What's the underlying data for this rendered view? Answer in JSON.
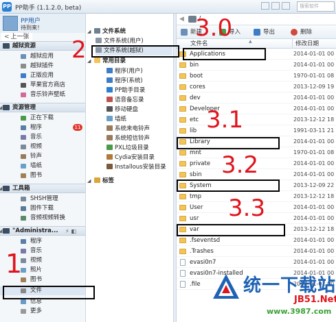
{
  "window": {
    "title": "PP助手 (1.1.2.0, beta)",
    "logo": "PP",
    "search_placeholder": "搜索软件"
  },
  "user": {
    "name": "PP用户",
    "login": "待到来！"
  },
  "back_label": "上一张",
  "sidebar": {
    "sections": [
      {
        "title": "越狱资源",
        "items": [
          {
            "label": "越狱应用"
          },
          {
            "label": "越狱插件"
          },
          {
            "label": "正版应用"
          },
          {
            "label": "苹果官方商店"
          },
          {
            "label": "音乐铃声壁纸"
          }
        ]
      },
      {
        "title": "资源管理",
        "items": [
          {
            "label": "正在下载"
          },
          {
            "label": "程序",
            "badge": "11"
          },
          {
            "label": "音乐"
          },
          {
            "label": "视频"
          },
          {
            "label": "铃声"
          },
          {
            "label": "墙纸"
          },
          {
            "label": "图书"
          }
        ]
      },
      {
        "title": "工具箱",
        "items": [
          {
            "label": "SHSH管理"
          },
          {
            "label": "固件下载"
          },
          {
            "label": "音频视频转换"
          }
        ]
      },
      {
        "title": "\"Administra...",
        "items": [
          {
            "label": "程序"
          },
          {
            "label": "音乐"
          },
          {
            "label": "视频"
          },
          {
            "label": "照片"
          },
          {
            "label": "图书"
          },
          {
            "label": "文件"
          },
          {
            "label": "信息"
          },
          {
            "label": "更多"
          }
        ]
      }
    ]
  },
  "tree": {
    "root1": "文件系统",
    "fs_user": "文件系统(用户)",
    "fs_jb": "文件系统(越狱)",
    "root2": "常用目录",
    "common": [
      "程序(用户)",
      "程序(系统)",
      "PP助手目录",
      "语音备忘录",
      "移动硬盘",
      "墙纸",
      "系统来电铃声",
      "系统短信铃声",
      "PXL垃圾目录",
      "Cydia安装目录",
      "Installous安装目录"
    ],
    "root3": "标签"
  },
  "path": "/",
  "toolbar": {
    "new": "新建",
    "import": "导入",
    "export": "导出",
    "delete": "删除"
  },
  "columns": {
    "name": "文件名",
    "date": "修改日期"
  },
  "files": [
    {
      "name": "Applications",
      "date": "2014-01-01 00",
      "type": "folder"
    },
    {
      "name": "bin",
      "date": "2014-01-01 00",
      "type": "folder"
    },
    {
      "name": "boot",
      "date": "1970-01-01 08",
      "type": "folder"
    },
    {
      "name": "cores",
      "date": "2013-12-09 19",
      "type": "folder"
    },
    {
      "name": "dev",
      "date": "2014-01-01 00",
      "type": "folder"
    },
    {
      "name": "Developer",
      "date": "2014-01-01 00",
      "type": "folder"
    },
    {
      "name": "etc",
      "date": "2013-12-12 18",
      "type": "folder"
    },
    {
      "name": "lib",
      "date": "1991-03-11 21",
      "type": "folder"
    },
    {
      "name": "Library",
      "date": "2014-01-01 00",
      "type": "folder"
    },
    {
      "name": "mnt",
      "date": "1970-01-01 08",
      "type": "folder"
    },
    {
      "name": "private",
      "date": "2014-01-01 00",
      "type": "folder"
    },
    {
      "name": "sbin",
      "date": "2014-01-01 00",
      "type": "folder"
    },
    {
      "name": "System",
      "date": "2013-12-09 22",
      "type": "folder"
    },
    {
      "name": "tmp",
      "date": "2013-12-12 18",
      "type": "folder"
    },
    {
      "name": "User",
      "date": "2014-01-01 00",
      "type": "folder"
    },
    {
      "name": "usr",
      "date": "2014-01-01 00",
      "type": "folder"
    },
    {
      "name": "var",
      "date": "2013-12-12 18",
      "type": "folder"
    },
    {
      "name": ".fseventsd",
      "date": "2014-01-01 00",
      "type": "folder"
    },
    {
      "name": ".Trashes",
      "date": "2014-01-01 00",
      "type": "folder"
    },
    {
      "name": "evasi0n7",
      "date": "2014-01-01 00",
      "type": "file"
    },
    {
      "name": "evasi0n7-installed",
      "date": "2014-01-01 00",
      "type": "file"
    },
    {
      "name": ".file",
      "date": "2014-01-01 00",
      "type": "file"
    }
  ],
  "annotations": {
    "a1": "1",
    "a2": "2",
    "a30": "3.0",
    "a31": "3.1",
    "a32": "3.2",
    "a33": "3.3"
  },
  "watermark": {
    "brand": "统一下载站",
    "site1": "JB51.Net",
    "site2": "www.3987.com"
  },
  "colors": {
    "accent": "#1f62b4",
    "annotation": "#e0141c",
    "folder": "#f2c45a"
  }
}
